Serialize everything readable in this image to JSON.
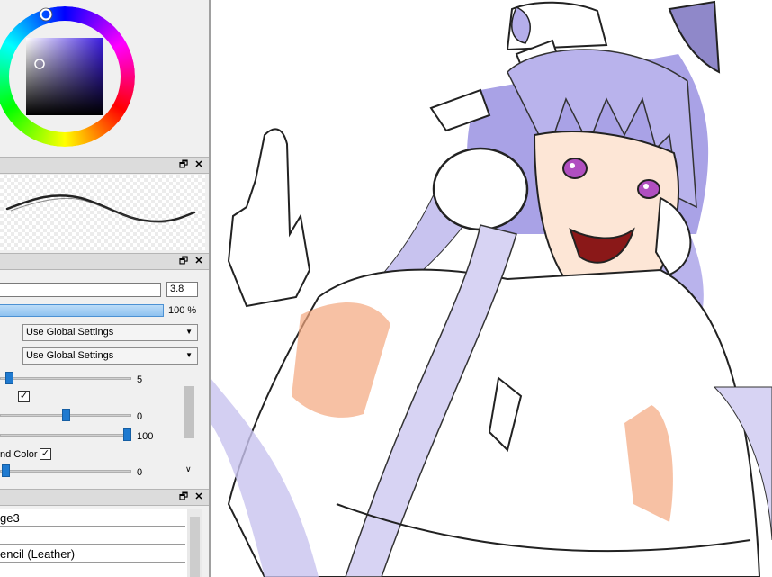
{
  "colors": {
    "panel_bg": "#f0f0f0",
    "accent": "#1f7ad0",
    "hair": "#b9b3ec"
  },
  "icons": {
    "restore": "restore-window-icon",
    "close": "close-icon",
    "check": "checkmark-icon",
    "dropdown": "dropdown-arrow-icon"
  },
  "glyphs": {
    "restore": "🗗",
    "close": "✕",
    "check": "✓",
    "arrow": "▼",
    "scroll_down": "∨"
  },
  "brush_settings": {
    "size_value": "3.8",
    "density_value": "100 %",
    "density_fill": 1.0,
    "select1": "Use Global Settings",
    "select2": "Use Global Settings",
    "slider1_value": "5",
    "slider2_value": "0",
    "slider3_value": "100",
    "checkbox_label": "nd Color",
    "slider4_value": "0"
  },
  "tool_list": {
    "items": [
      "ge3",
      "",
      "encil (Leather)",
      ""
    ]
  }
}
